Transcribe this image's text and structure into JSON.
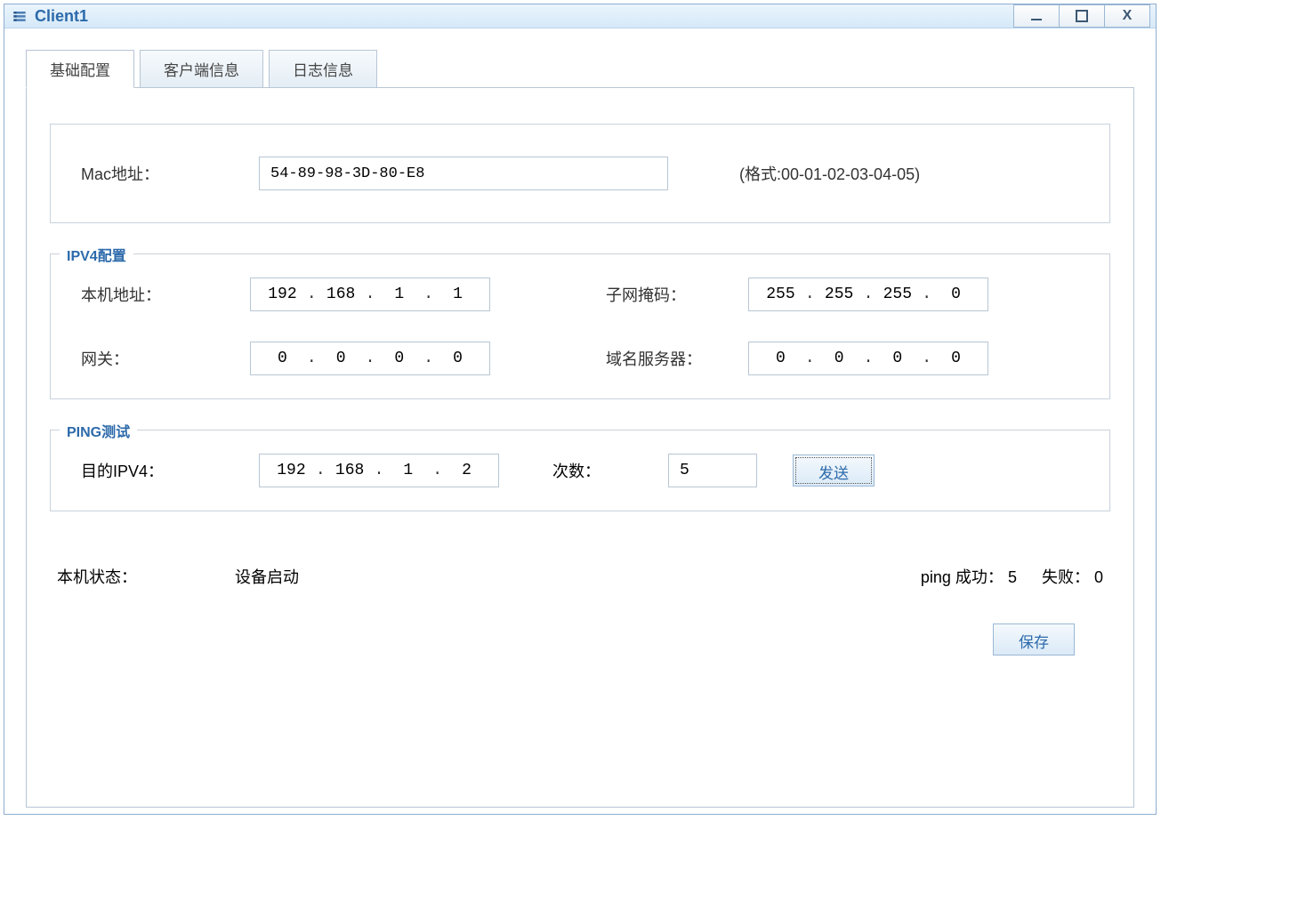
{
  "window": {
    "title": "Client1"
  },
  "tabs": {
    "basic": "基础配置",
    "client_info": "客户端信息",
    "log_info": "日志信息"
  },
  "mac_section": {
    "label": "Mac地址：",
    "value": "54-89-98-3D-80-E8",
    "hint": "(格式:00-01-02-03-04-05)"
  },
  "ipv4_section": {
    "legend": "IPV4配置",
    "local_label": "本机地址：",
    "local_ip": [
      "192",
      "168",
      "1",
      "1"
    ],
    "mask_label": "子网掩码：",
    "mask_ip": [
      "255",
      "255",
      "255",
      "0"
    ],
    "gateway_label": "网关：",
    "gateway_ip": [
      "0",
      "0",
      "0",
      "0"
    ],
    "dns_label": "域名服务器：",
    "dns_ip": [
      "0",
      "0",
      "0",
      "0"
    ]
  },
  "ping_section": {
    "legend": "PING测试",
    "dest_label": "目的IPV4：",
    "dest_ip": [
      "192",
      "168",
      "1",
      "2"
    ],
    "count_label": "次数：",
    "count_value": "5",
    "send_btn": "发送"
  },
  "status": {
    "label": "本机状态：",
    "value": "设备启动",
    "ping_success_label": "ping 成功：",
    "ping_success_value": "5",
    "ping_fail_label": "失败：",
    "ping_fail_value": "0"
  },
  "save_btn": "保存"
}
